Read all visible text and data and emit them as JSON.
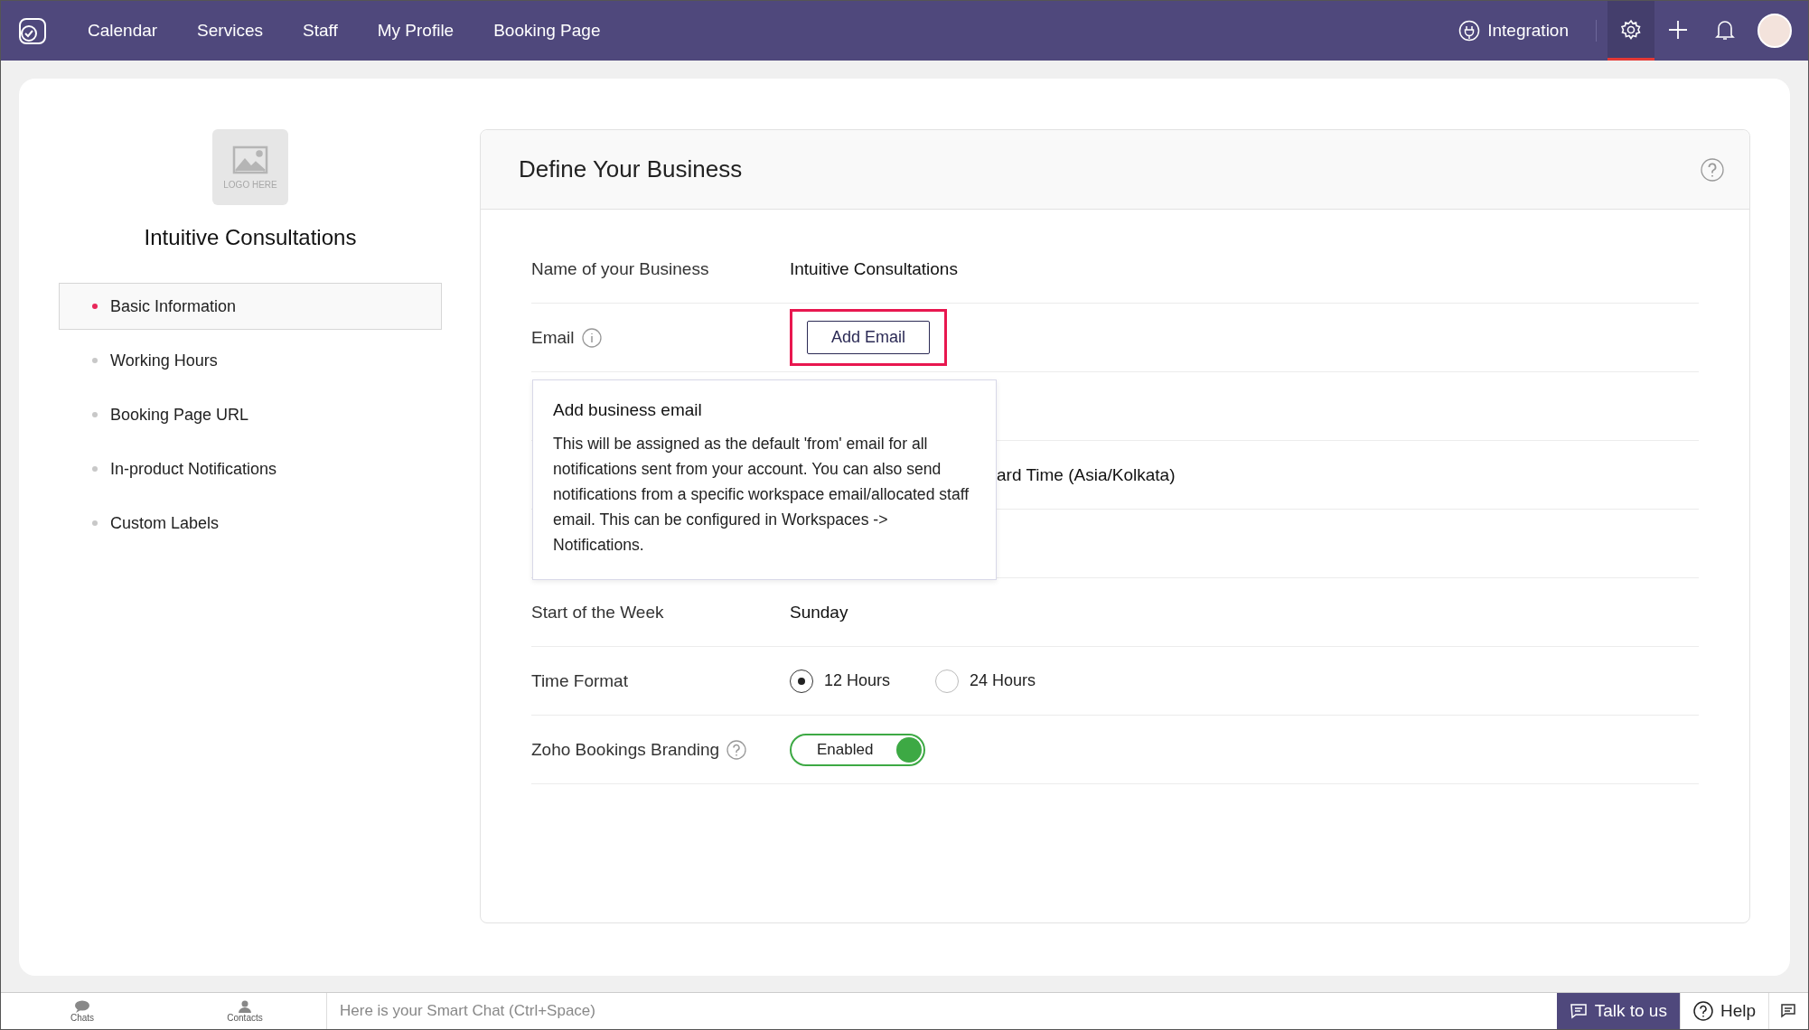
{
  "nav": {
    "items": [
      {
        "label": "Calendar",
        "selected": false
      },
      {
        "label": "Services",
        "selected": false
      },
      {
        "label": "Staff",
        "selected": false
      },
      {
        "label": "My Profile",
        "selected": false
      },
      {
        "label": "Booking Page",
        "selected": false
      }
    ],
    "integration": "Integration",
    "settings_selected": true
  },
  "profile": {
    "logo_text": "LOGO HERE",
    "name": "Intuitive Consultations"
  },
  "sidebar": {
    "items": [
      {
        "label": "Basic Information",
        "selected": true
      },
      {
        "label": "Working Hours",
        "selected": false
      },
      {
        "label": "Booking Page URL",
        "selected": false
      },
      {
        "label": "In-product Notifications",
        "selected": false
      },
      {
        "label": "Custom Labels",
        "selected": false
      }
    ]
  },
  "panel": {
    "title": "Define Your Business",
    "rows": [
      {
        "kind": "text",
        "label": "Name of your Business",
        "value": "Intuitive Consultations"
      },
      {
        "kind": "email",
        "label": "Email",
        "button": "Add Email",
        "highlighted": true
      },
      {
        "kind": "covered"
      },
      {
        "kind": "covered",
        "value": "ard Time (Asia/Kolkata)"
      },
      {
        "kind": "covered"
      },
      {
        "kind": "text",
        "label": "Start of the Week",
        "value": "Sunday"
      },
      {
        "kind": "radio",
        "label": "Time Format",
        "options": [
          {
            "label": "12 Hours",
            "selected": true
          },
          {
            "label": "24 Hours",
            "selected": false
          }
        ]
      },
      {
        "kind": "toggle",
        "label": "Zoho Bookings Branding",
        "toggle": {
          "label": "Enabled",
          "on": true
        }
      }
    ],
    "tooltip": {
      "title": "Add business email",
      "body": "This will be assigned as the default 'from' email for all notifications sent from your account. You can also send notifications from a specific workspace email/allocated staff email. This can be configured in Workspaces -> Notifications."
    }
  },
  "bottom_bar": {
    "chats": "Chats",
    "contacts": "Contacts",
    "chat_placeholder": "Here is your Smart Chat (Ctrl+Space)",
    "talk": "Talk to us",
    "help": "Help"
  }
}
